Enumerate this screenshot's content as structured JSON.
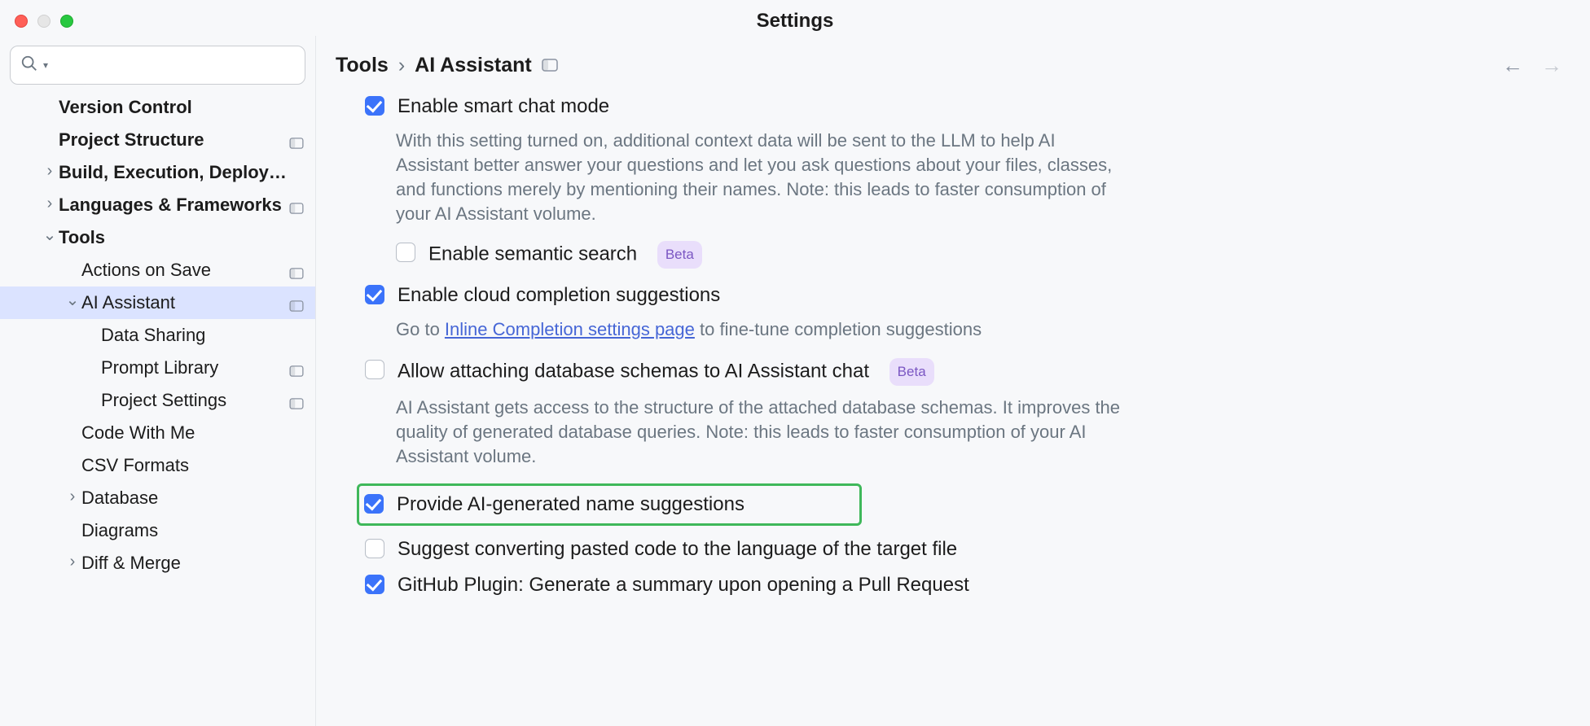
{
  "window": {
    "title": "Settings"
  },
  "breadcrumb": {
    "root": "Tools",
    "leaf": "AI Assistant"
  },
  "sidebar": {
    "items": [
      {
        "label": "Version Control",
        "level": 1,
        "bold": true,
        "caret": "",
        "tag": false,
        "selected": false
      },
      {
        "label": "Project Structure",
        "level": 1,
        "bold": true,
        "caret": "",
        "tag": true,
        "selected": false
      },
      {
        "label": "Build, Execution, Deployment",
        "level": 1,
        "bold": true,
        "caret": "right",
        "tag": false,
        "selected": false
      },
      {
        "label": "Languages & Frameworks",
        "level": 1,
        "bold": true,
        "caret": "right",
        "tag": true,
        "selected": false
      },
      {
        "label": "Tools",
        "level": 1,
        "bold": true,
        "caret": "down",
        "tag": false,
        "selected": false
      },
      {
        "label": "Actions on Save",
        "level": 2,
        "bold": false,
        "caret": "",
        "tag": true,
        "selected": false
      },
      {
        "label": "AI Assistant",
        "level": 2,
        "bold": false,
        "caret": "down",
        "tag": true,
        "selected": true
      },
      {
        "label": "Data Sharing",
        "level": 3,
        "bold": false,
        "caret": "",
        "tag": false,
        "selected": false
      },
      {
        "label": "Prompt Library",
        "level": 3,
        "bold": false,
        "caret": "",
        "tag": true,
        "selected": false
      },
      {
        "label": "Project Settings",
        "level": 3,
        "bold": false,
        "caret": "",
        "tag": true,
        "selected": false
      },
      {
        "label": "Code With Me",
        "level": 2,
        "bold": false,
        "caret": "",
        "tag": false,
        "selected": false
      },
      {
        "label": "CSV Formats",
        "level": 2,
        "bold": false,
        "caret": "",
        "tag": false,
        "selected": false
      },
      {
        "label": "Database",
        "level": 2,
        "bold": false,
        "caret": "right",
        "tag": false,
        "selected": false
      },
      {
        "label": "Diagrams",
        "level": 2,
        "bold": false,
        "caret": "",
        "tag": false,
        "selected": false
      },
      {
        "label": "Diff & Merge",
        "level": 2,
        "bold": false,
        "caret": "right",
        "tag": false,
        "selected": false
      }
    ]
  },
  "settings": {
    "smart_chat": {
      "label": "Enable smart chat mode",
      "checked": true,
      "desc": "With this setting turned on, additional context data will be sent to the LLM to help AI Assistant better answer your questions and let you ask questions about your files, classes, and functions merely by mentioning their names. Note: this leads to faster consumption of your AI Assistant volume."
    },
    "semantic_search": {
      "label": "Enable semantic search",
      "checked": false,
      "badge": "Beta"
    },
    "cloud_completion": {
      "label": "Enable cloud completion suggestions",
      "checked": true,
      "desc_prefix": "Go to ",
      "desc_link": "Inline Completion settings page",
      "desc_suffix": " to fine-tune completion suggestions"
    },
    "db_schemas": {
      "label": "Allow attaching database schemas to AI Assistant chat",
      "checked": false,
      "badge": "Beta",
      "desc": "AI Assistant gets access to the structure of the attached database schemas. It improves the quality of generated database queries. Note: this leads to faster consumption of your AI Assistant volume."
    },
    "name_suggestions": {
      "label": "Provide AI-generated name suggestions",
      "checked": true
    },
    "convert_paste": {
      "label": "Suggest converting pasted code to the language of the target file",
      "checked": false
    },
    "github_pr": {
      "label": "GitHub Plugin: Generate a summary upon opening a Pull Request",
      "checked": true
    }
  }
}
